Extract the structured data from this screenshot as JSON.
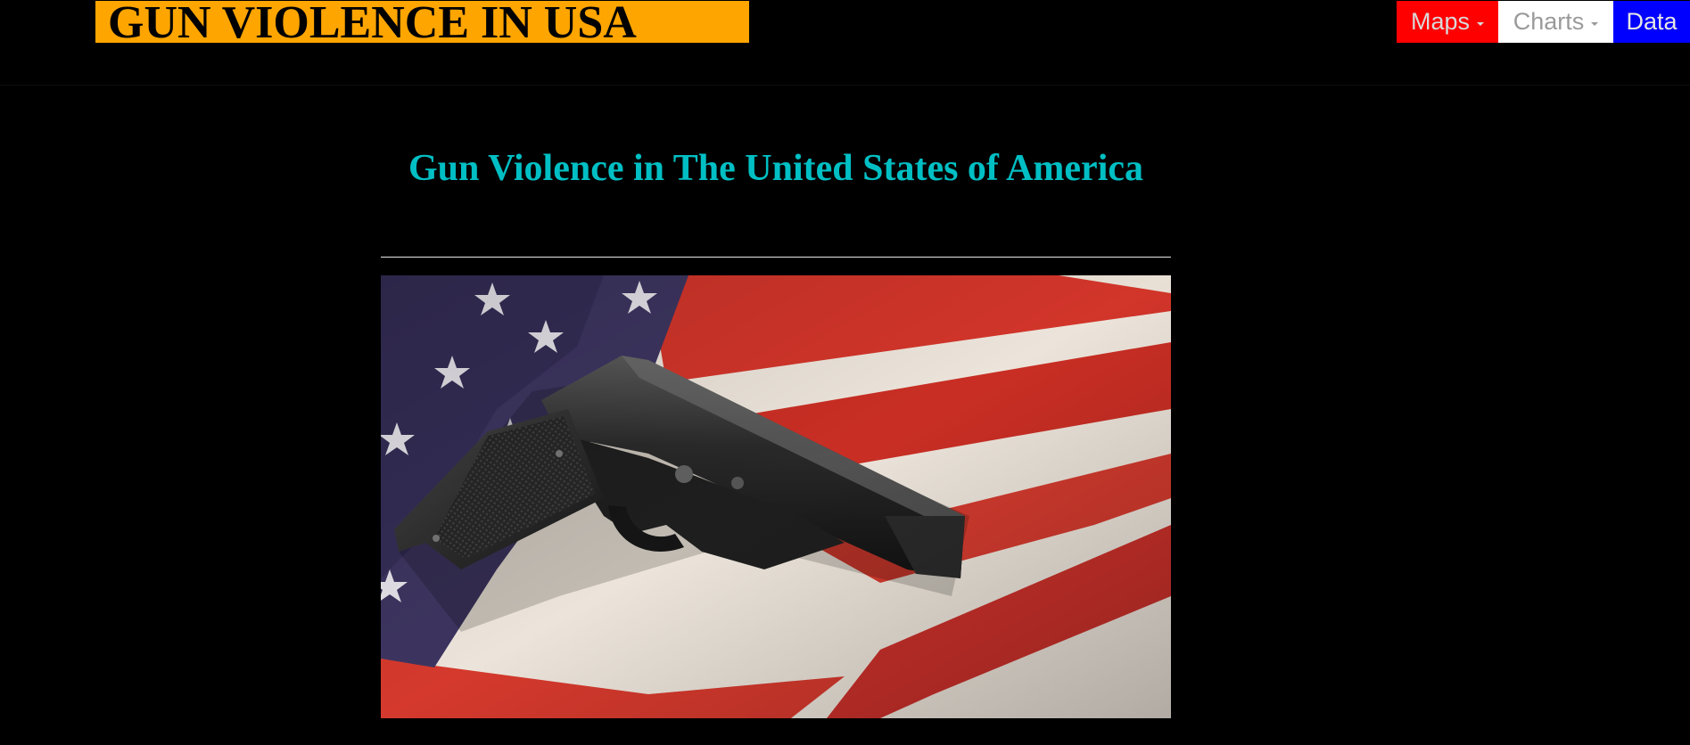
{
  "header": {
    "brand": "GUN VIOLENCE IN USA",
    "nav": {
      "maps": "Maps",
      "charts": "Charts",
      "data": "Data"
    }
  },
  "main": {
    "title": "Gun Violence in The United States of America",
    "hero_image": "american-flag-with-handgun"
  },
  "colors": {
    "page_background": "#000000",
    "brand_background": "#ffa500",
    "title_text": "#00bfc4",
    "nav_maps": "#ff0000",
    "nav_charts": "#ffffff",
    "nav_data": "#0000ff"
  }
}
